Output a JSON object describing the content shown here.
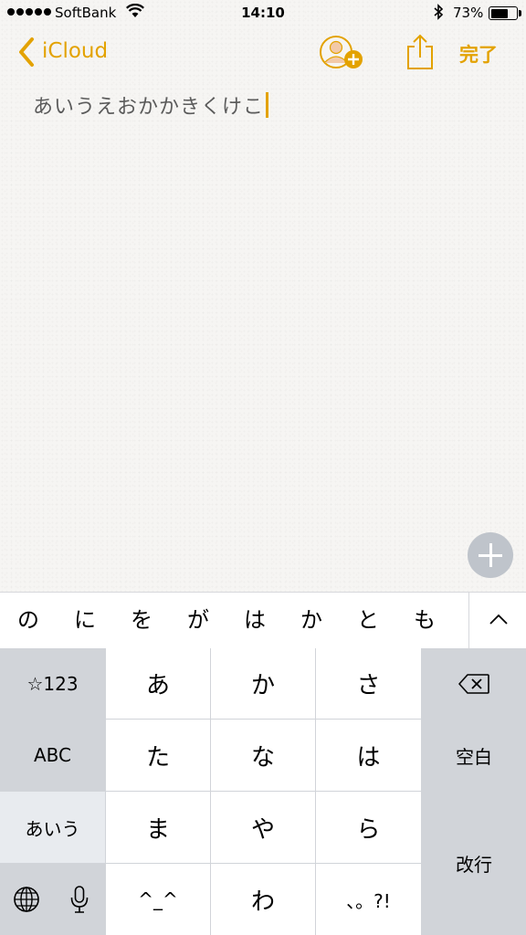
{
  "status_bar": {
    "carrier": "SoftBank",
    "time": "14:10",
    "battery_percent": "73%",
    "battery_level": 0.73,
    "signal_bars": 5
  },
  "nav": {
    "back_label": "iCloud",
    "done_label": "完了"
  },
  "note": {
    "text": "あいうえおかかきくけこ"
  },
  "candidates": [
    "の",
    "に",
    "を",
    "が",
    "は",
    "か",
    "と",
    "も"
  ],
  "keyboard": {
    "symbols_key": "☆123",
    "abc_key": "ABC",
    "kana_key": "あいう",
    "row1": [
      "あ",
      "か",
      "さ"
    ],
    "row2": [
      "た",
      "な",
      "は"
    ],
    "row3": [
      "ま",
      "や",
      "ら"
    ],
    "row4": [
      "^_^",
      "わ",
      "、。?!"
    ],
    "space_key": "空白",
    "return_key": "改行"
  },
  "colors": {
    "accent": "#e3a200",
    "keyboard_gray": "#d1d4d9"
  }
}
